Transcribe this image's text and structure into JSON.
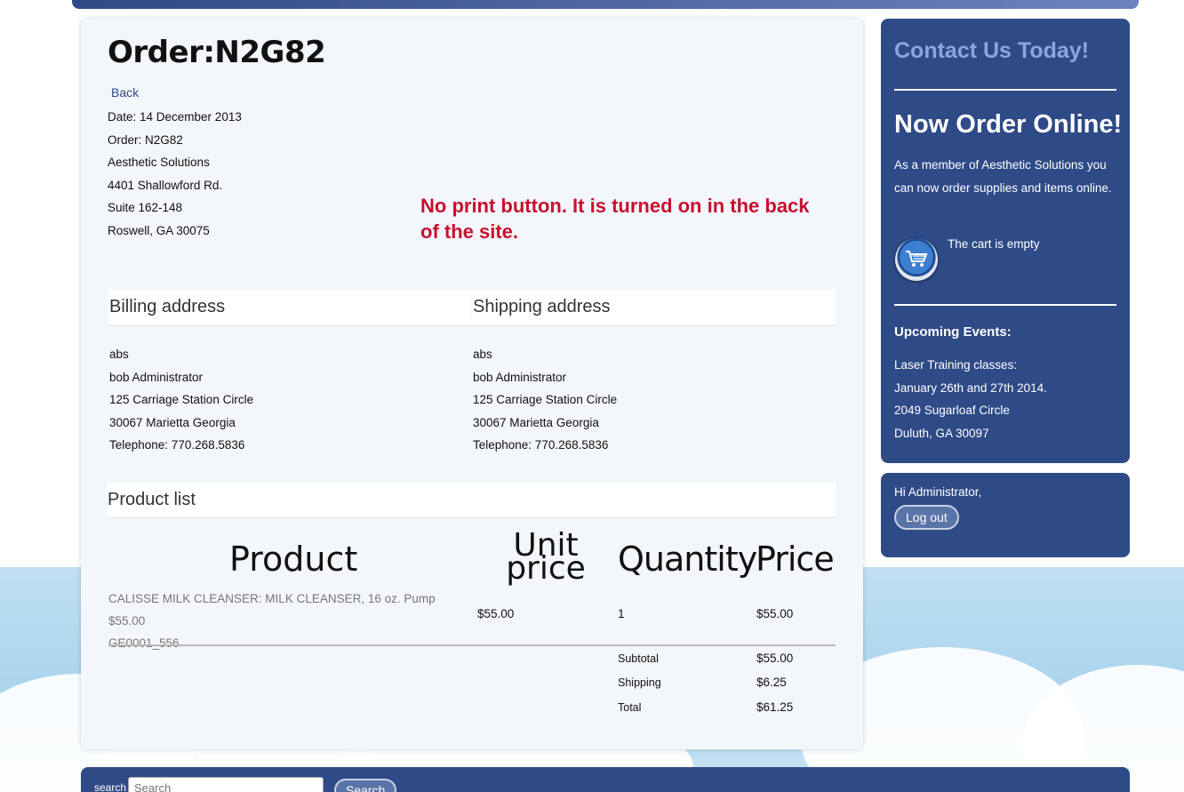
{
  "order": {
    "title": "Order:N2G82",
    "back_label": "Back",
    "info_lines": [
      "Date: 14 December 2013",
      "Order: N2G82",
      "Aesthetic Solutions",
      "4401 Shallowford Rd.",
      "Suite 162-148",
      "Roswell, GA 30075"
    ]
  },
  "annotation": "No print button. It is turned on in the back of the site.",
  "billing": {
    "heading": "Billing address",
    "lines": [
      "abs",
      "bob Administrator",
      "125 Carriage Station Circle",
      "30067 Marietta Georgia",
      "Telephone: 770.268.5836"
    ]
  },
  "shipping": {
    "heading": "Shipping address",
    "lines": [
      "abs",
      "bob Administrator",
      "125 Carriage Station Circle",
      "30067 Marietta Georgia",
      "Telephone: 770.268.5836"
    ]
  },
  "product_list": {
    "heading": "Product list",
    "columns": {
      "product": "Product",
      "unit_line1": "Unit",
      "unit_line2": "price",
      "quantity": "Quantity",
      "price": "Price"
    },
    "rows": [
      {
        "name": "CALISSE MILK CLEANSER: MILK CLEANSER, 16 oz. Pump $55.00",
        "sku": "GE0001_556",
        "unit_price": "$55.00",
        "quantity": "1",
        "price": "$55.00"
      }
    ],
    "totals": {
      "subtotal_label": "Subtotal",
      "subtotal": "$55.00",
      "shipping_label": "Shipping",
      "shipping": "$6.25",
      "total_label": "Total",
      "total": "$61.25"
    }
  },
  "sidebar": {
    "contact": "Contact Us Today!",
    "now_order": "Now Order Online!",
    "member_text": "As a member of Aesthetic Solutions you can now order supplies and items online.",
    "cart_status": "The cart is empty",
    "events_heading": "Upcoming Events:",
    "events": [
      "Laser Training classes:",
      "January 26th and 27th 2014.",
      "2049 Sugarloaf Circle",
      "Duluth, GA 30097"
    ],
    "greeting": "Hi Administrator,",
    "logout_label": "Log out"
  },
  "footer": {
    "search_label": "search",
    "search_placeholder": "Search",
    "search_button": "Search"
  },
  "colors": {
    "accent": "#2e4a87",
    "annotation": "#c8102e",
    "contact": "#8aa6dc"
  }
}
